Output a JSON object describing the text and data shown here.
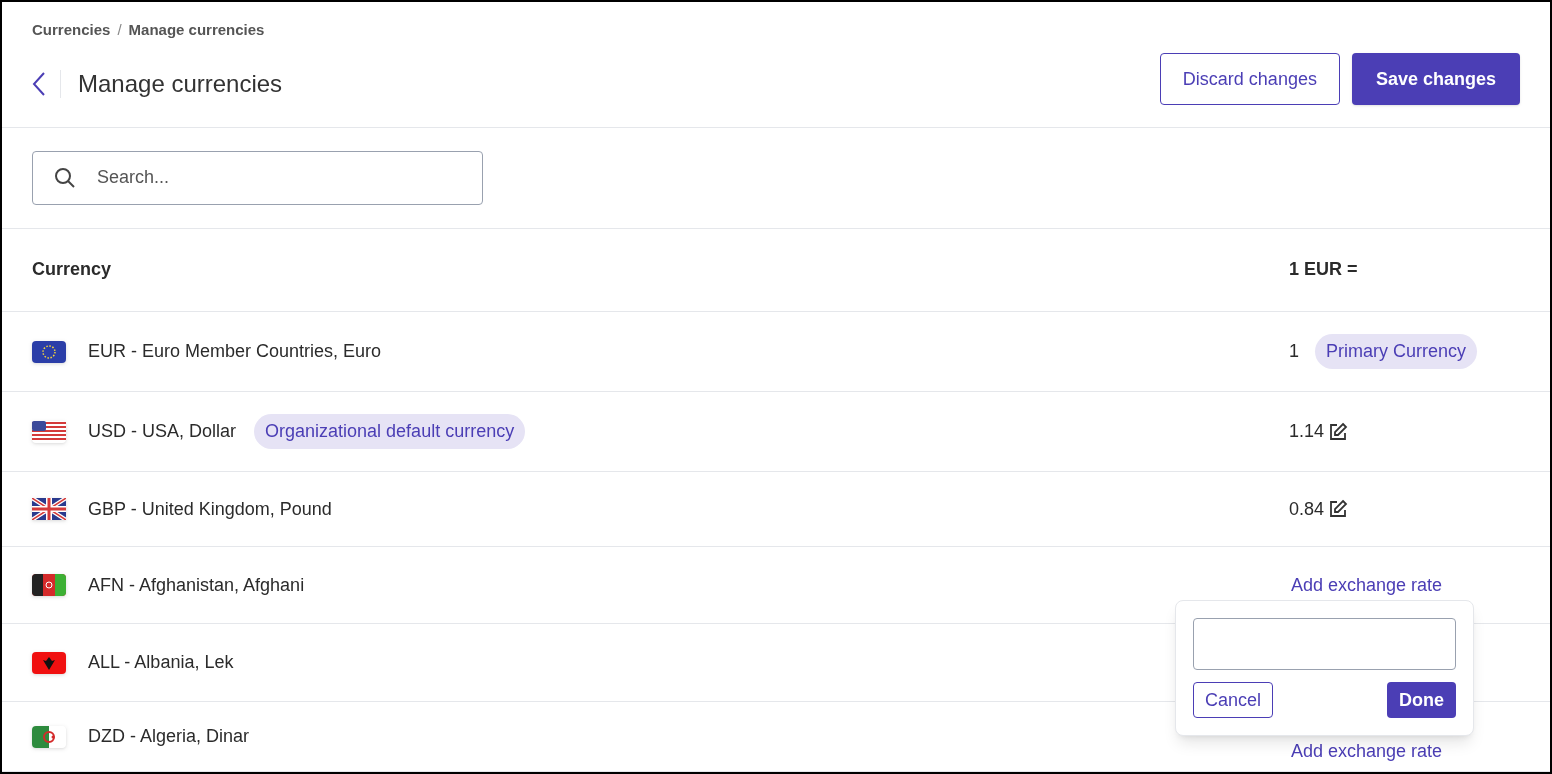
{
  "breadcrumb": {
    "items": [
      "Currencies",
      "Manage currencies"
    ],
    "separator": "/"
  },
  "title": "Manage currencies",
  "actions": {
    "discard": "Discard changes",
    "save": "Save changes"
  },
  "search": {
    "placeholder": "Search..."
  },
  "table": {
    "columns": [
      "Currency",
      "1 EUR ="
    ],
    "rows": [
      {
        "name": "EUR - Euro Member Countries, Euro",
        "kind": "primary",
        "rate": "1",
        "rate_badge": "Primary Currency"
      },
      {
        "name": "USD - USA, Dollar",
        "badge": "Organizational default currency",
        "kind": "editable",
        "rate": "1.14"
      },
      {
        "name": "GBP - United Kingdom, Pound",
        "kind": "editable",
        "rate": "0.84"
      },
      {
        "name": "AFN - Afghanistan, Afghani",
        "kind": "add",
        "rate": "Add exchange rate",
        "popover": {
          "cancel": "Cancel",
          "done": "Done"
        }
      },
      {
        "name": "ALL - Albania, Lek",
        "kind": "none"
      },
      {
        "name": "DZD - Algeria, Dinar",
        "kind": "add",
        "rate": "Add exchange rate"
      }
    ]
  }
}
